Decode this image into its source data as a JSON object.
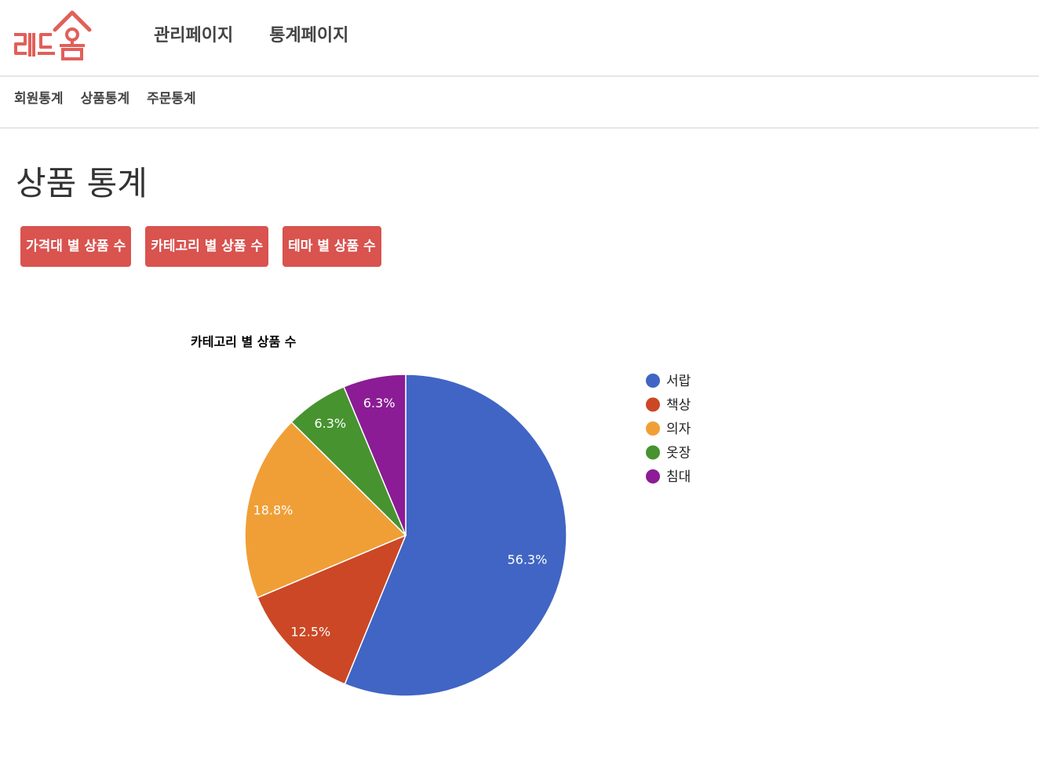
{
  "header": {
    "logo_text": "레드옴",
    "nav": [
      {
        "label": "관리페이지"
      },
      {
        "label": "통계페이지"
      }
    ],
    "brand_color": "#e06059"
  },
  "subnav": {
    "items": [
      {
        "label": "회원통계"
      },
      {
        "label": "상품통계"
      },
      {
        "label": "주문통계"
      }
    ]
  },
  "main": {
    "title": "상품 통계",
    "buttons": [
      {
        "label": "가격대 별 상품 수"
      },
      {
        "label": "카테고리 별 상품 수"
      },
      {
        "label": "테마 별 상품 수"
      }
    ],
    "button_color": "#d9534f"
  },
  "chart_data": {
    "type": "pie",
    "title": "카테고리 별 상품 수",
    "legend_position": "right",
    "slices": [
      {
        "label": "서랍",
        "value": 56.3,
        "display": "56.3%",
        "color": "#4065c4"
      },
      {
        "label": "책상",
        "value": 12.5,
        "display": "12.5%",
        "color": "#cc4725"
      },
      {
        "label": "의자",
        "value": 18.8,
        "display": "18.8%",
        "color": "#f09f37"
      },
      {
        "label": "옷장",
        "value": 6.3,
        "display": "6.3%",
        "color": "#47932f"
      },
      {
        "label": "침대",
        "value": 6.3,
        "display": "6.3%",
        "color": "#8b1c95"
      }
    ]
  }
}
